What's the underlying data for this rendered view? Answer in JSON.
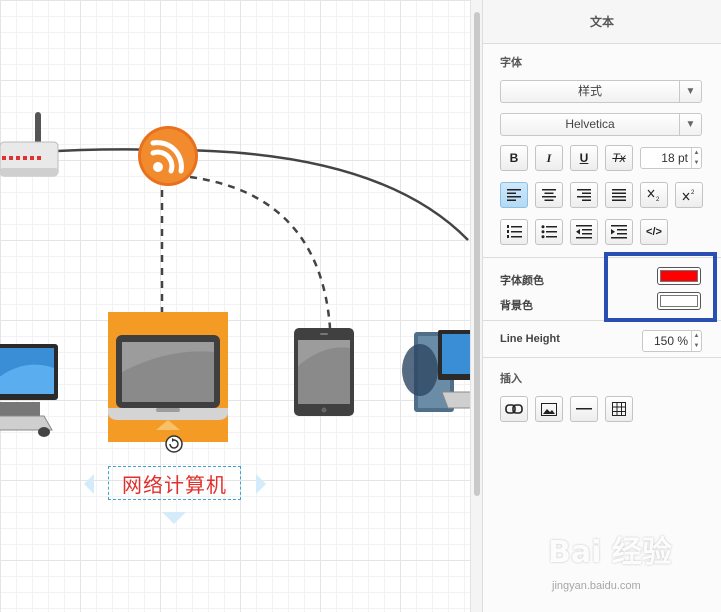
{
  "panel": {
    "title": "文本",
    "font_section": "字体",
    "style_select": "样式",
    "font_select": "Helvetica",
    "font_size": "18 pt",
    "format_buttons": [
      "B",
      "I",
      "U",
      "Tx"
    ],
    "font_color_label": "字体颜色",
    "bg_color_label": "背景色",
    "font_color": "#ff0000",
    "bg_color": "#ffffff",
    "line_height_label": "Line Height",
    "line_height_value": "150 %",
    "insert_section": "插入"
  },
  "canvas": {
    "selected_label": "网络计算机"
  },
  "watermark": {
    "main": "Bai 经验",
    "sub": "jingyan.baidu.com"
  }
}
